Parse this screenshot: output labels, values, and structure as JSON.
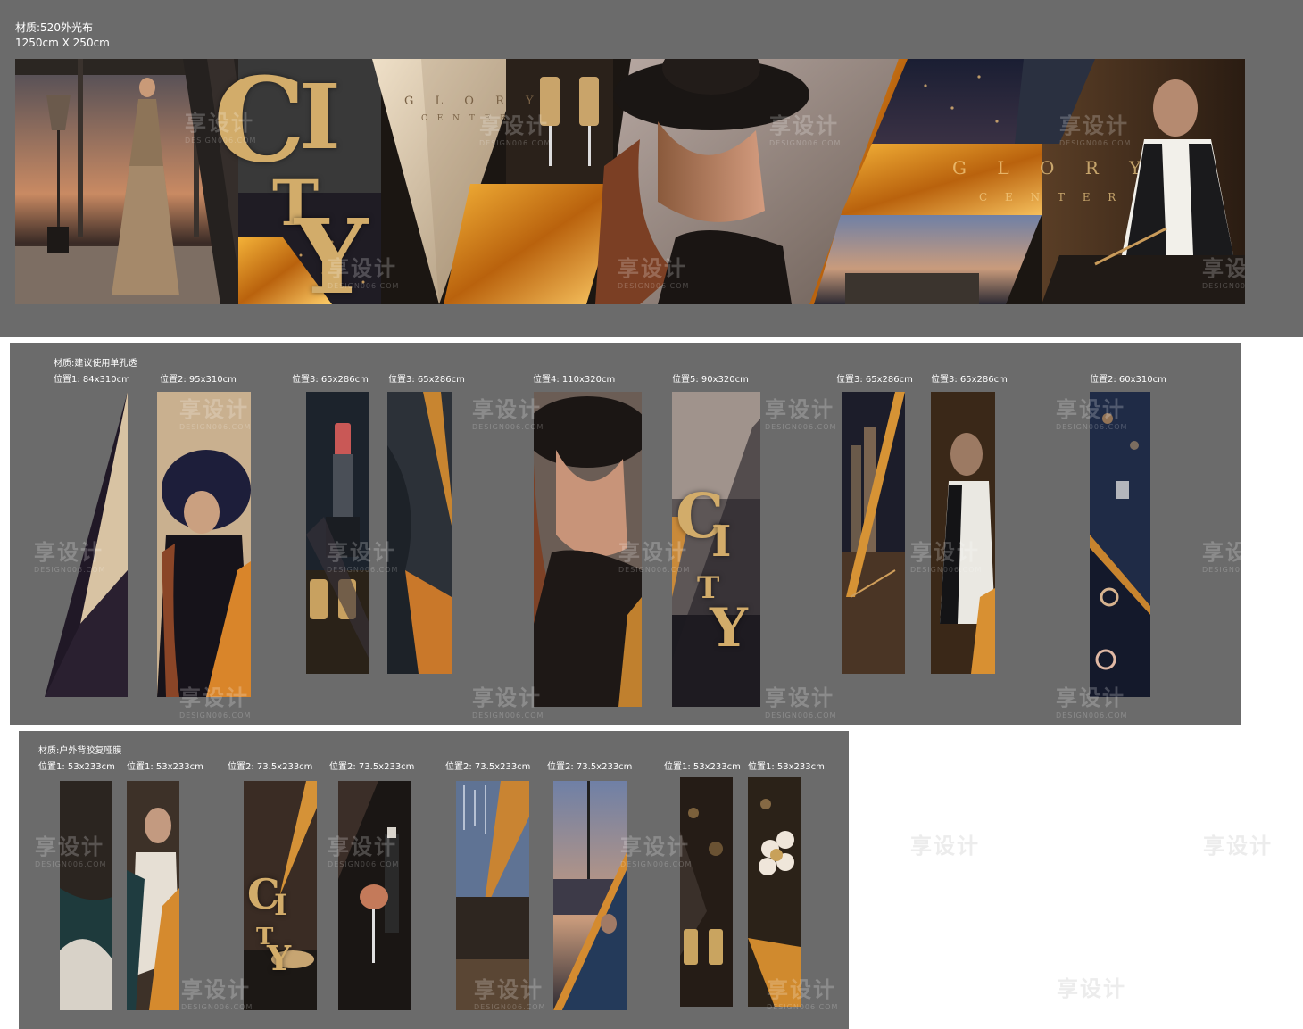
{
  "banner": {
    "material": "材质:520外光布",
    "size": "1250cm X 250cm",
    "brand_line1": "G L O R Y",
    "brand_line2": "C E N T E R",
    "city_c": "C",
    "city_i": "I",
    "city_t": "T",
    "city_y": "Y",
    "brand_right_line1": "G L O R Y",
    "brand_right_line2": "C E N T E R"
  },
  "section2": {
    "material": "材质:建议使用单孔透",
    "labels": [
      "位置1: 84x310cm",
      "位置2: 95x310cm",
      "位置3: 65x286cm",
      "位置3: 65x286cm",
      "位置4: 110x320cm",
      "位置5: 90x320cm",
      "位置3: 65x286cm",
      "位置3: 65x286cm",
      "位置2: 60x310cm"
    ]
  },
  "section3": {
    "material": "材质:户外背胶复哑膜",
    "labels": [
      "位置1: 53x233cm",
      "位置1: 53x233cm",
      "位置2: 73.5x233cm",
      "位置2: 73.5x233cm",
      "位置2: 73.5x233cm",
      "位置2: 73.5x233cm",
      "位置1: 53x233cm",
      "位置1: 53x233cm"
    ]
  },
  "watermark": {
    "cn": "享设计",
    "en": "DESIGN006.COM"
  },
  "colors": {
    "panel_gray": "#6b6b6b",
    "gold": "#d2ac6a",
    "amber": "#e08a1c",
    "dark": "#1b1612"
  }
}
